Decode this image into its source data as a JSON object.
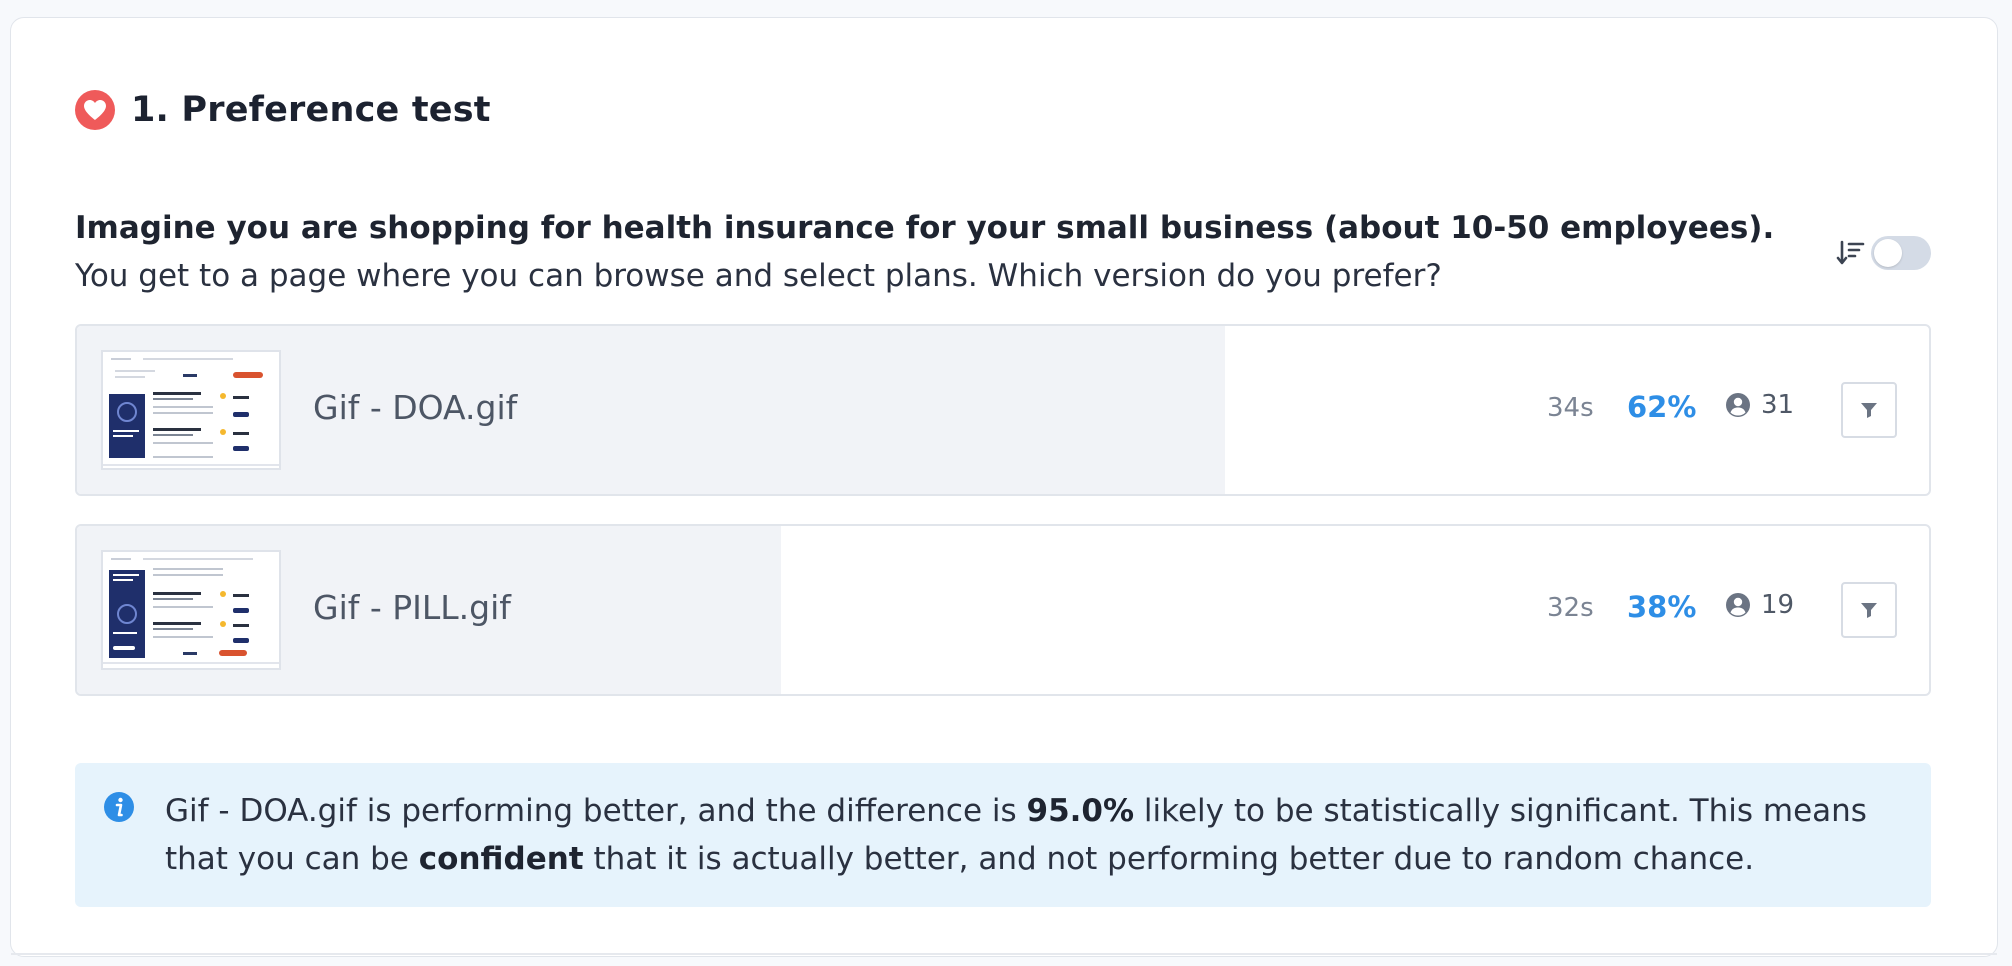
{
  "section": {
    "number_title": "1. Preference test",
    "icon": "heart-icon",
    "accent_color": "#ef5a5a"
  },
  "question": {
    "bold": "Imagine you are shopping for health insurance for your small business (about 10-50 employees).",
    "rest": " You get to a page where you can browse and select plans. Which version do you prefer?"
  },
  "sort": {
    "icon": "sort-descending-icon",
    "toggle_on": false
  },
  "options": [
    {
      "name": "Gif - DOA.gif",
      "time": "34s",
      "percent_label": "62%",
      "share": 0.62,
      "count": "31",
      "filter_icon": "filter-icon"
    },
    {
      "name": "Gif - PILL.gif",
      "time": "32s",
      "percent_label": "38%",
      "share": 0.38,
      "count": "19",
      "filter_icon": "filter-icon"
    }
  ],
  "note": {
    "icon": "info-icon",
    "part1": "Gif - DOA.gif is performing better, and the difference is ",
    "bold1": "95.0%",
    "part2": " likely to be statistically significant. This means that you can be ",
    "bold2": "confident",
    "part3": " that it is actually better, and not performing better due to random chance."
  },
  "colors": {
    "percent": "#2e8ee6",
    "info_bg": "#e6f3fc",
    "bar_fill": "#f1f3f7"
  }
}
